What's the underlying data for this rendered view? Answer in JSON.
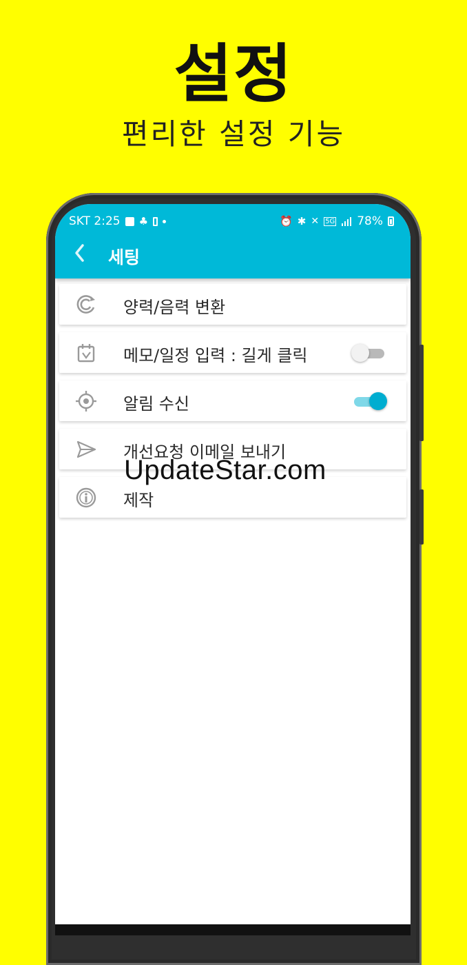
{
  "promo": {
    "title": "설정",
    "subtitle": "편리한 설정 기능"
  },
  "statusbar": {
    "carrier_time": "SKT 2:25",
    "network": "5G",
    "battery": "78%"
  },
  "toolbar": {
    "title": "세팅",
    "back_icon": "chevron-left-icon"
  },
  "settings": {
    "items": [
      {
        "label": "양력/음력 변환",
        "icon": "convert-circle-icon"
      },
      {
        "label": "메모/일정 입력 : 길게 클릭",
        "icon": "calendar-icon",
        "toggle": false
      },
      {
        "label": "알림 수신",
        "icon": "target-icon",
        "toggle": true
      },
      {
        "label": "개선요청 이메일 보내기",
        "icon": "send-icon"
      },
      {
        "label": "제작",
        "icon": "info-icon"
      }
    ]
  },
  "watermark": "UpdateStar.com",
  "colors": {
    "background": "#fffe00",
    "appbar": "#00b9d8",
    "toggle_on": "#00add0"
  }
}
